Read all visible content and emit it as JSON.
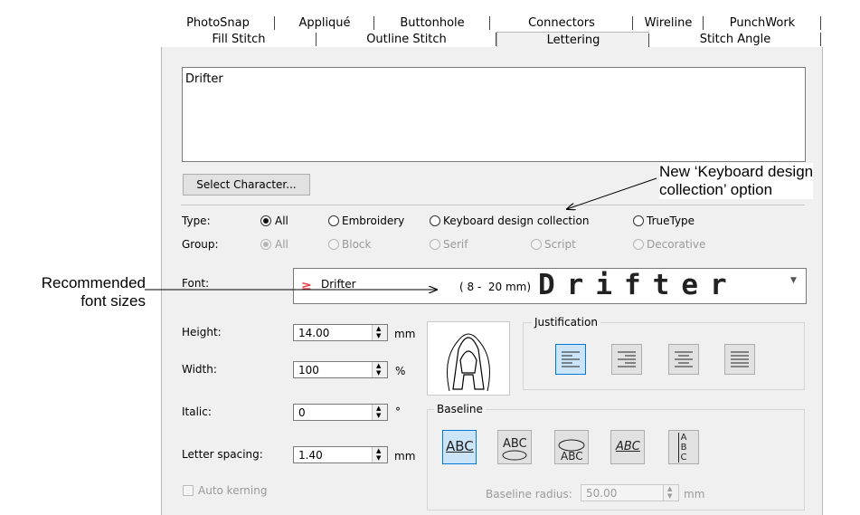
{
  "tabs_row1": [
    "PhotoSnap",
    "Appliqué",
    "Buttonhole",
    "Connectors",
    "Wireline",
    "PunchWork"
  ],
  "tabs_row2": [
    "Fill Stitch",
    "Outline Stitch",
    "Lettering",
    "Stitch Angle"
  ],
  "selected_tab": "Lettering",
  "text_area_value": "Drifter",
  "select_character_label": "Select Character...",
  "type": {
    "label": "Type:",
    "options": [
      "All",
      "Embroidery",
      "Keyboard design collection",
      "TrueType"
    ],
    "selected": "All"
  },
  "group": {
    "label": "Group:",
    "options": [
      "All",
      "Block",
      "Serif",
      "Script",
      "Decorative"
    ],
    "selected": "All"
  },
  "font": {
    "label": "Font:",
    "name": "Drifter",
    "size_range": "( 8 -  20 mm)",
    "preview_text": "Drifter"
  },
  "height": {
    "label": "Height:",
    "value": "14.00",
    "unit": "mm"
  },
  "width": {
    "label": "Width:",
    "value": "100",
    "unit": "%"
  },
  "italic": {
    "label": "Italic:",
    "value": "0",
    "unit": "°"
  },
  "letter_spacing": {
    "label": "Letter spacing:",
    "value": "1.40",
    "unit": "mm"
  },
  "auto_kerning_label": "Auto kerning",
  "justification_label": "Justification",
  "baseline_label": "Baseline",
  "baseline_radius": {
    "label": "Baseline radius:",
    "value": "50.00",
    "unit": "mm"
  },
  "baseline_glyphs": [
    "ABC",
    "ABC",
    "ABC",
    "ABC",
    "ABC"
  ],
  "annotations": {
    "keyboard_note_line1": "New ‘Keyboard design",
    "keyboard_note_line2": "collection’ option",
    "font_note_line1": "Recommended",
    "font_note_line2": "font sizes"
  },
  "colors": {
    "accent": "#0078d7",
    "panel": "#f0f0f0",
    "font_icon": "#e8404a"
  }
}
